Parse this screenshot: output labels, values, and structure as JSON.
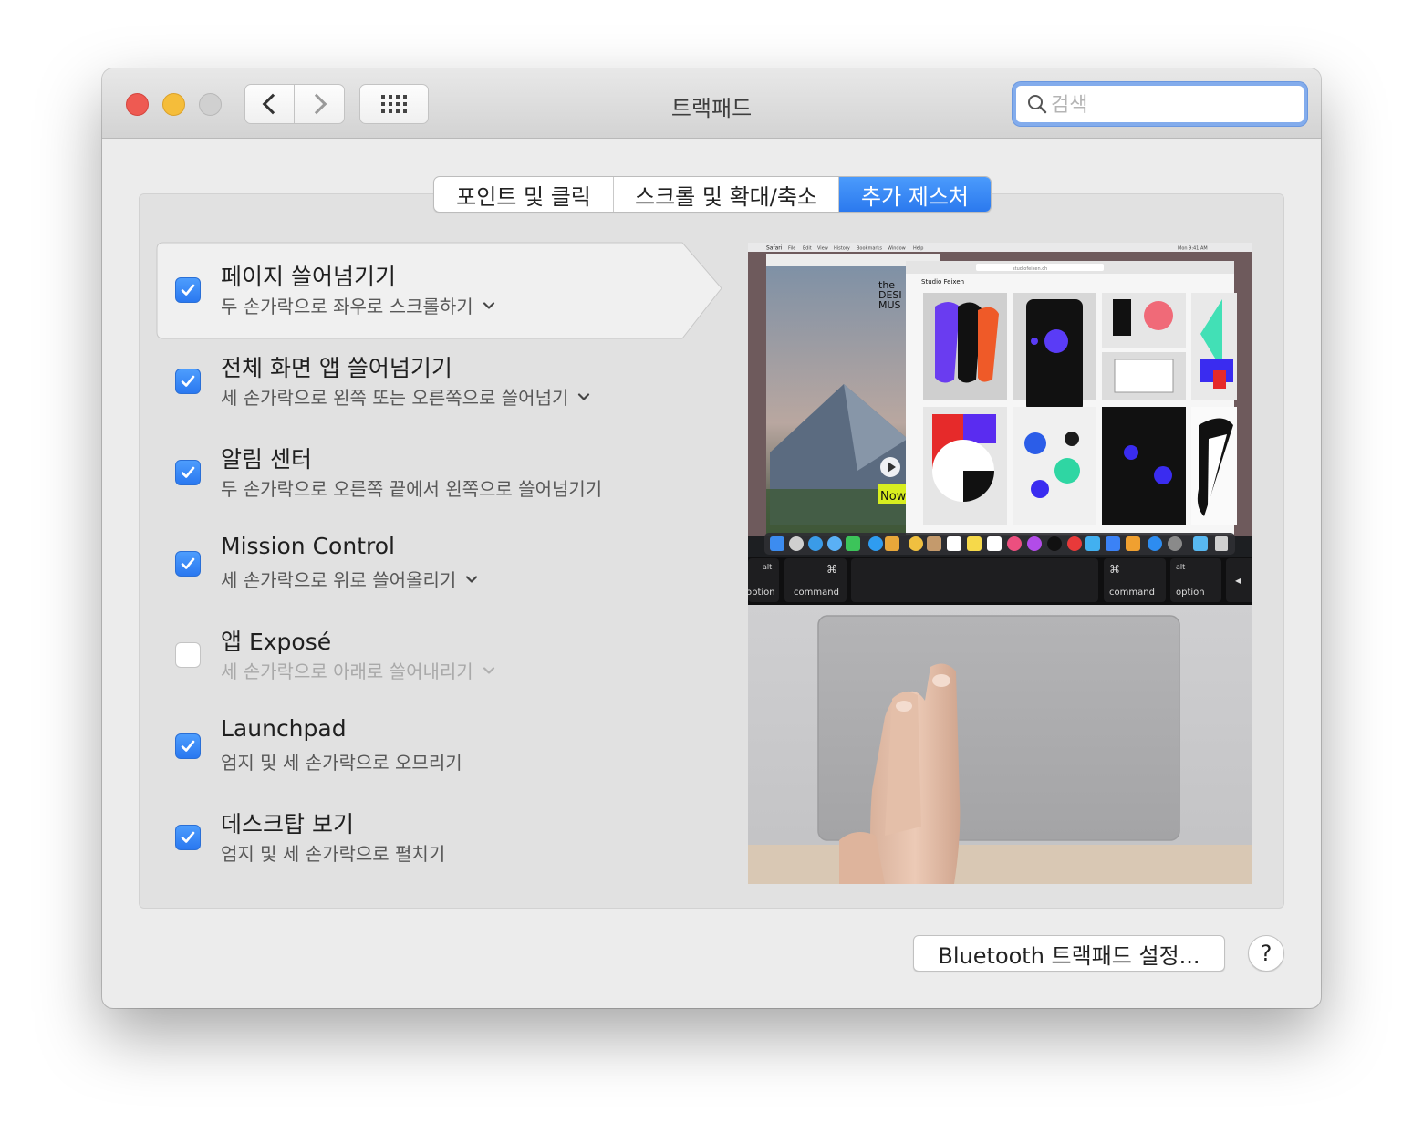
{
  "window": {
    "title": "트랙패드",
    "search": {
      "placeholder": "검색",
      "value": ""
    }
  },
  "tabs": [
    {
      "label": "포인트 및 클릭",
      "selected": false
    },
    {
      "label": "스크롤 및 확대/축소",
      "selected": false
    },
    {
      "label": "추가 제스처",
      "selected": true
    }
  ],
  "options": [
    {
      "title": "페이지 쓸어넘기기",
      "subtitle": "두 손가락으로 좌우로 스크롤하기",
      "checked": true,
      "has_menu": true,
      "selected": true
    },
    {
      "title": "전체 화면 앱 쓸어넘기기",
      "subtitle": "세 손가락으로 왼쪽 또는 오른쪽으로 쓸어넘기",
      "checked": true,
      "has_menu": true
    },
    {
      "title": "알림 센터",
      "subtitle": "두 손가락으로 오른쪽 끝에서 왼쪽으로 쓸어넘기기",
      "checked": true,
      "has_menu": false
    },
    {
      "title": "Mission Control",
      "subtitle": "세 손가락으로 위로 쓸어올리기",
      "checked": true,
      "has_menu": true
    },
    {
      "title": "앱 Exposé",
      "subtitle": "세 손가락으로 아래로 쓸어내리기",
      "checked": false,
      "has_menu": true
    },
    {
      "title": "Launchpad",
      "subtitle": "엄지 및 세 손가락으로 오므리기",
      "checked": true,
      "has_menu": false
    },
    {
      "title": "데스크탑 보기",
      "subtitle": "엄지 및 세 손가락으로 펼치기",
      "checked": true,
      "has_menu": false
    }
  ],
  "preview": {
    "menubar": {
      "app": "Safari",
      "items": [
        "File",
        "Edit",
        "View",
        "History",
        "Bookmarks",
        "Window",
        "Help"
      ],
      "clock": "Mon 9:41 AM"
    },
    "site_title": "Studio Feixen",
    "url": "studiofeixen.ch",
    "left_site_logo": [
      "the",
      "DESI",
      "MUS"
    ],
    "now_label": "Now",
    "keys": [
      "alt",
      "option",
      "⌘",
      "command",
      "⌘",
      "command",
      "alt",
      "option",
      "◀"
    ]
  },
  "footer": {
    "bluetooth_button": "Bluetooth 트랙패드 설정...",
    "help_button": "?"
  },
  "colors": {
    "accent": "#2f7ff2",
    "close": "#ee5a52",
    "minimize": "#f5bd3a"
  }
}
